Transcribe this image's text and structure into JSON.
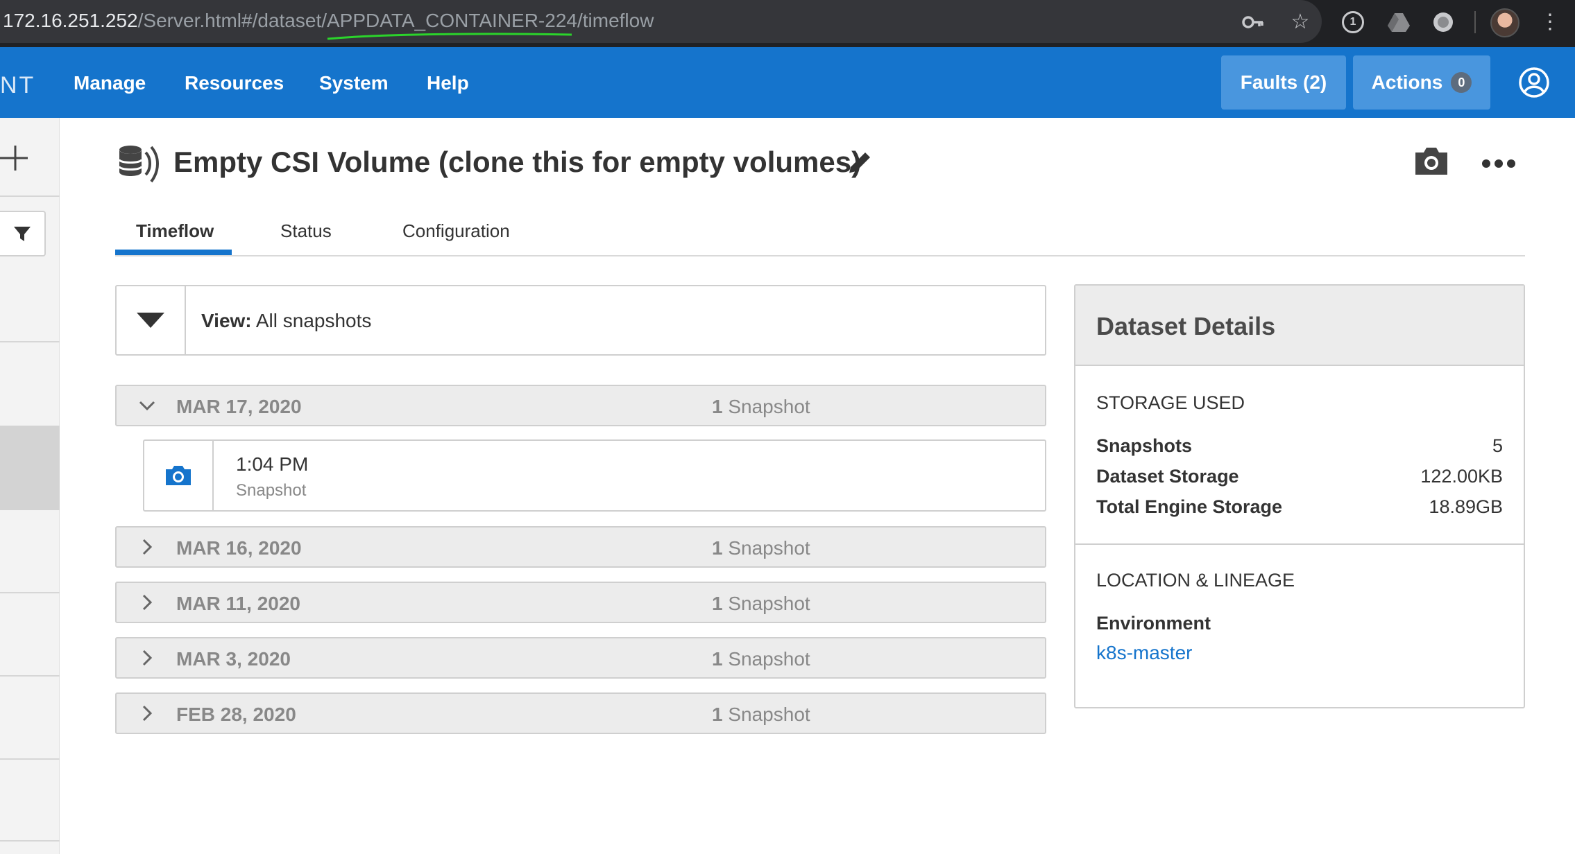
{
  "browser": {
    "url_host": "172.16.251.252",
    "url_path": "/Server.html#/dataset/APPDATA_CONTAINER-224/timeflow",
    "icons": [
      "key-icon",
      "star-icon",
      "extension-1-icon",
      "drive-icon",
      "extension-circle-icon",
      "profile-avatar",
      "menu-kebab-icon"
    ],
    "extension_badge": "1"
  },
  "header": {
    "brand_fragment": "NT",
    "nav": [
      "Manage",
      "Resources",
      "System",
      "Help"
    ],
    "faults_label": "Faults (2)",
    "actions_label": "Actions",
    "actions_count": "0",
    "accent_color": "#1574cc"
  },
  "page": {
    "title": "Empty CSI Volume (clone this for empty volumes)",
    "tabs": [
      "Timeflow",
      "Status",
      "Configuration"
    ],
    "active_tab": "Timeflow"
  },
  "view": {
    "prefix": "View:",
    "value": "All snapshots"
  },
  "timeflow": {
    "groups": [
      {
        "date": "MAR 17, 2020",
        "count_num": "1",
        "count_label": "Snapshot",
        "expanded": true
      },
      {
        "date": "MAR 16, 2020",
        "count_num": "1",
        "count_label": "Snapshot",
        "expanded": false
      },
      {
        "date": "MAR 11, 2020",
        "count_num": "1",
        "count_label": "Snapshot",
        "expanded": false
      },
      {
        "date": "MAR 3, 2020",
        "count_num": "1",
        "count_label": "Snapshot",
        "expanded": false
      },
      {
        "date": "FEB 28, 2020",
        "count_num": "1",
        "count_label": "Snapshot",
        "expanded": false
      }
    ],
    "snapshot": {
      "time": "1:04 PM",
      "type": "Snapshot"
    }
  },
  "details": {
    "title": "Dataset Details",
    "storage_heading": "STORAGE USED",
    "storage": [
      {
        "label": "Snapshots",
        "value": "5"
      },
      {
        "label": "Dataset Storage",
        "value": "122.00KB"
      },
      {
        "label": "Total Engine Storage",
        "value": "18.89GB"
      }
    ],
    "location_heading": "LOCATION & LINEAGE",
    "environment_label": "Environment",
    "environment_value": "k8s-master"
  }
}
